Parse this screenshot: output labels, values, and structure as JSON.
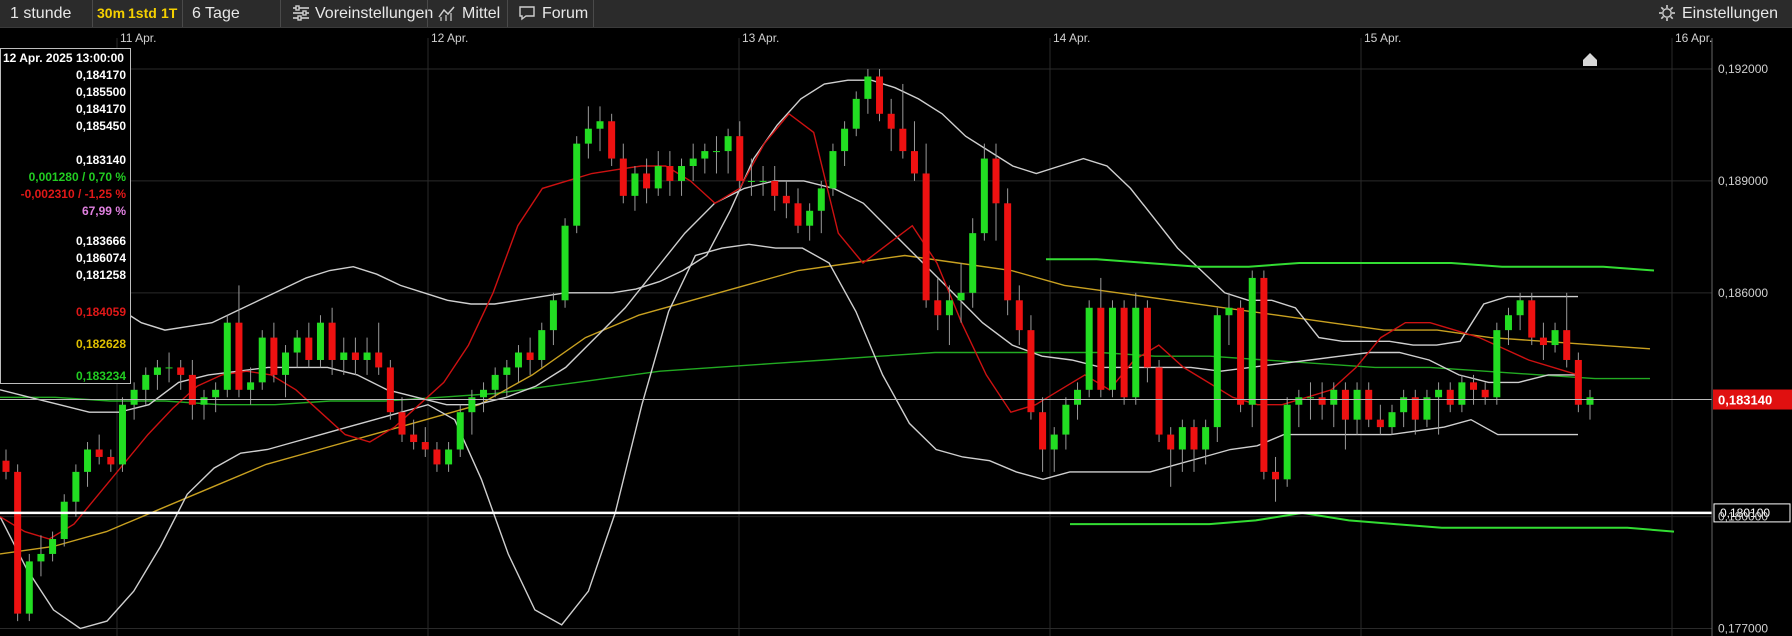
{
  "toolbar": {
    "interval_label": "1 stunde",
    "tf_30m": "30m",
    "tf_1std": "1std",
    "tf_1t": "1T",
    "range_label": "6 Tage",
    "presets_label": "Voreinstellungen",
    "indicator_label": "Mittel",
    "forum_label": "Forum",
    "settings_label": "Einstellungen"
  },
  "colors": {
    "up": "#22dd22",
    "down": "#ee1111",
    "bollinger": "#cfcfcf",
    "ma_fast": "#cc1111",
    "ma_mid": "#c8a020",
    "ma_slow": "#22aa22",
    "channel": "#33dd33"
  },
  "infobox": {
    "date": "12 Apr. 2025 13:00:00",
    "open": "0,184170",
    "high": "0,185500",
    "low": "0,184170",
    "close": "0,185450",
    "last": "0,183140",
    "change_pos": "0,001280 / 0,70 %",
    "change_neg": "-0,002310 / -1,25 %",
    "pct": "67,99 %",
    "v1": "0,183666",
    "v2": "0,186074",
    "v3": "0,181258",
    "ma_red": "0,184059",
    "ma_yellow": "0,182628",
    "ma_green": "0,183234"
  },
  "chart_data": {
    "type": "candlestick",
    "x_labels": [
      "11 Apr.",
      "12 Apr.",
      "13 Apr.",
      "14 Apr.",
      "15 Apr.",
      "16 Apr."
    ],
    "y_ticks": [
      "0,192000",
      "0,189000",
      "0,186000",
      "0,180000",
      "0,177000"
    ],
    "ylim": [
      0.1768,
      0.1931
    ],
    "last_price": 0.18314,
    "last_price_label": "0,183140",
    "support_level": 0.1801,
    "support_label": "0,180100",
    "grid": true,
    "candles": [
      [
        0.1815,
        0.1818,
        0.181,
        0.1812
      ],
      [
        0.1812,
        0.1814,
        0.1772,
        0.1774
      ],
      [
        0.1774,
        0.179,
        0.1772,
        0.1788
      ],
      [
        0.1788,
        0.1795,
        0.1784,
        0.179
      ],
      [
        0.179,
        0.1796,
        0.1788,
        0.1794
      ],
      [
        0.1794,
        0.1806,
        0.1792,
        0.1804
      ],
      [
        0.1804,
        0.1814,
        0.18,
        0.1812
      ],
      [
        0.1812,
        0.182,
        0.1808,
        0.1818
      ],
      [
        0.1818,
        0.1822,
        0.1814,
        0.1816
      ],
      [
        0.1816,
        0.1818,
        0.1812,
        0.1814
      ],
      [
        0.1814,
        0.1832,
        0.1812,
        0.183
      ],
      [
        0.183,
        0.1836,
        0.1826,
        0.1834
      ],
      [
        0.1834,
        0.184,
        0.183,
        0.1838
      ],
      [
        0.1838,
        0.1842,
        0.1834,
        0.184
      ],
      [
        0.184,
        0.1844,
        0.1836,
        0.184
      ],
      [
        0.184,
        0.1842,
        0.1834,
        0.1838
      ],
      [
        0.1838,
        0.1842,
        0.1826,
        0.183
      ],
      [
        0.183,
        0.1834,
        0.1826,
        0.1832
      ],
      [
        0.1832,
        0.1836,
        0.1828,
        0.1834
      ],
      [
        0.1834,
        0.1854,
        0.1832,
        0.1852
      ],
      [
        0.1852,
        0.1862,
        0.1832,
        0.1834
      ],
      [
        0.1834,
        0.184,
        0.183,
        0.1836
      ],
      [
        0.1836,
        0.185,
        0.1834,
        0.1848
      ],
      [
        0.1848,
        0.1852,
        0.1836,
        0.1838
      ],
      [
        0.1838,
        0.1846,
        0.1832,
        0.1844
      ],
      [
        0.1844,
        0.185,
        0.184,
        0.1848
      ],
      [
        0.1848,
        0.1852,
        0.184,
        0.1842
      ],
      [
        0.1842,
        0.1854,
        0.184,
        0.1852
      ],
      [
        0.1852,
        0.1856,
        0.1838,
        0.1842
      ],
      [
        0.1842,
        0.1848,
        0.1838,
        0.1844
      ],
      [
        0.1844,
        0.1848,
        0.1838,
        0.1842
      ],
      [
        0.1842,
        0.1848,
        0.1838,
        0.1844
      ],
      [
        0.1844,
        0.1852,
        0.1838,
        0.184
      ],
      [
        0.184,
        0.1842,
        0.1826,
        0.1828
      ],
      [
        0.1828,
        0.1832,
        0.182,
        0.1822
      ],
      [
        0.1822,
        0.1826,
        0.1818,
        0.182
      ],
      [
        0.182,
        0.1824,
        0.1816,
        0.1818
      ],
      [
        0.1818,
        0.182,
        0.1812,
        0.1814
      ],
      [
        0.1814,
        0.182,
        0.1812,
        0.1818
      ],
      [
        0.1818,
        0.183,
        0.1816,
        0.1828
      ],
      [
        0.1828,
        0.1834,
        0.1822,
        0.1832
      ],
      [
        0.1832,
        0.1836,
        0.1828,
        0.1834
      ],
      [
        0.1834,
        0.184,
        0.1832,
        0.1838
      ],
      [
        0.1838,
        0.1842,
        0.1832,
        0.184
      ],
      [
        0.184,
        0.1846,
        0.1836,
        0.1844
      ],
      [
        0.1844,
        0.1848,
        0.1838,
        0.1842
      ],
      [
        0.1842,
        0.1852,
        0.184,
        0.185
      ],
      [
        0.185,
        0.186,
        0.1846,
        0.1858
      ],
      [
        0.1858,
        0.188,
        0.1856,
        0.1878
      ],
      [
        0.1878,
        0.1902,
        0.1876,
        0.19
      ],
      [
        0.19,
        0.191,
        0.1896,
        0.1904
      ],
      [
        0.1904,
        0.191,
        0.1898,
        0.1906
      ],
      [
        0.1906,
        0.1908,
        0.1894,
        0.1896
      ],
      [
        0.1896,
        0.19,
        0.1884,
        0.1886
      ],
      [
        0.1886,
        0.1894,
        0.1882,
        0.1892
      ],
      [
        0.1892,
        0.1896,
        0.1884,
        0.1888
      ],
      [
        0.1888,
        0.1898,
        0.1886,
        0.1894
      ],
      [
        0.1894,
        0.1898,
        0.1886,
        0.189
      ],
      [
        0.189,
        0.1896,
        0.1886,
        0.1894
      ],
      [
        0.1894,
        0.19,
        0.189,
        0.1896
      ],
      [
        0.1896,
        0.19,
        0.1892,
        0.1898
      ],
      [
        0.1898,
        0.1902,
        0.1892,
        0.1898
      ],
      [
        0.1898,
        0.1904,
        0.1892,
        0.1902
      ],
      [
        0.1902,
        0.1906,
        0.1888,
        0.189
      ],
      [
        0.189,
        0.1896,
        0.1886,
        0.189
      ],
      [
        0.189,
        0.1894,
        0.1886,
        0.189
      ],
      [
        0.189,
        0.1894,
        0.1882,
        0.1886
      ],
      [
        0.1886,
        0.189,
        0.188,
        0.1884
      ],
      [
        0.1884,
        0.1888,
        0.1876,
        0.1878
      ],
      [
        0.1878,
        0.1884,
        0.1874,
        0.1882
      ],
      [
        0.1882,
        0.189,
        0.1876,
        0.1888
      ],
      [
        0.1888,
        0.19,
        0.1886,
        0.1898
      ],
      [
        0.1898,
        0.1906,
        0.1894,
        0.1904
      ],
      [
        0.1904,
        0.1914,
        0.1902,
        0.1912
      ],
      [
        0.1912,
        0.192,
        0.1908,
        0.1918
      ],
      [
        0.1918,
        0.192,
        0.1906,
        0.1908
      ],
      [
        0.1908,
        0.1912,
        0.1898,
        0.1904
      ],
      [
        0.1904,
        0.1916,
        0.1896,
        0.1898
      ],
      [
        0.1898,
        0.1906,
        0.189,
        0.1892
      ],
      [
        0.1892,
        0.19,
        0.1856,
        0.1858
      ],
      [
        0.1858,
        0.1864,
        0.185,
        0.1854
      ],
      [
        0.1854,
        0.1862,
        0.1846,
        0.1858
      ],
      [
        0.1858,
        0.1868,
        0.1852,
        0.186
      ],
      [
        0.186,
        0.188,
        0.1856,
        0.1876
      ],
      [
        0.1876,
        0.19,
        0.1874,
        0.1896
      ],
      [
        0.1896,
        0.19,
        0.1874,
        0.1884
      ],
      [
        0.1884,
        0.1888,
        0.1854,
        0.1858
      ],
      [
        0.1858,
        0.1862,
        0.1846,
        0.185
      ],
      [
        0.185,
        0.1854,
        0.1826,
        0.1828
      ],
      [
        0.1828,
        0.1832,
        0.1812,
        0.1818
      ],
      [
        0.1818,
        0.1824,
        0.1812,
        0.1822
      ],
      [
        0.1822,
        0.1832,
        0.1818,
        0.183
      ],
      [
        0.183,
        0.1836,
        0.1826,
        0.1834
      ],
      [
        0.1834,
        0.1858,
        0.1832,
        0.1856
      ],
      [
        0.1856,
        0.1864,
        0.1832,
        0.1834
      ],
      [
        0.1834,
        0.1858,
        0.1832,
        0.1856
      ],
      [
        0.1856,
        0.1858,
        0.183,
        0.1832
      ],
      [
        0.1832,
        0.186,
        0.183,
        0.1856
      ],
      [
        0.1856,
        0.1858,
        0.1836,
        0.184
      ],
      [
        0.184,
        0.1842,
        0.182,
        0.1822
      ],
      [
        0.1822,
        0.1824,
        0.1808,
        0.1818
      ],
      [
        0.1818,
        0.1826,
        0.1812,
        0.1824
      ],
      [
        0.1824,
        0.1826,
        0.1812,
        0.1818
      ],
      [
        0.1818,
        0.1826,
        0.1814,
        0.1824
      ],
      [
        0.1824,
        0.1856,
        0.182,
        0.1854
      ],
      [
        0.1854,
        0.186,
        0.1846,
        0.1856
      ],
      [
        0.1856,
        0.1858,
        0.1828,
        0.183
      ],
      [
        0.183,
        0.1866,
        0.1824,
        0.1864
      ],
      [
        0.1864,
        0.1866,
        0.181,
        0.1812
      ],
      [
        0.1812,
        0.1816,
        0.1804,
        0.181
      ],
      [
        0.181,
        0.1832,
        0.1808,
        0.183
      ],
      [
        0.183,
        0.1834,
        0.1824,
        0.1832
      ],
      [
        0.1832,
        0.1836,
        0.1826,
        0.1832
      ],
      [
        0.1832,
        0.1836,
        0.1826,
        0.183
      ],
      [
        0.183,
        0.1836,
        0.1824,
        0.1834
      ],
      [
        0.1834,
        0.1836,
        0.1818,
        0.1826
      ],
      [
        0.1826,
        0.1836,
        0.1822,
        0.1834
      ],
      [
        0.1834,
        0.1836,
        0.1824,
        0.1826
      ],
      [
        0.1826,
        0.183,
        0.1822,
        0.1824
      ],
      [
        0.1824,
        0.183,
        0.1822,
        0.1828
      ],
      [
        0.1828,
        0.1834,
        0.1824,
        0.1832
      ],
      [
        0.1832,
        0.1834,
        0.1822,
        0.1826
      ],
      [
        0.1826,
        0.1834,
        0.1824,
        0.1832
      ],
      [
        0.1832,
        0.1836,
        0.1822,
        0.1834
      ],
      [
        0.1834,
        0.1836,
        0.1828,
        0.183
      ],
      [
        0.183,
        0.1838,
        0.1828,
        0.1836
      ],
      [
        0.1836,
        0.1838,
        0.183,
        0.1834
      ],
      [
        0.1834,
        0.1836,
        0.183,
        0.1832
      ],
      [
        0.1832,
        0.1852,
        0.183,
        0.185
      ],
      [
        0.185,
        0.1856,
        0.1846,
        0.1854
      ],
      [
        0.1854,
        0.186,
        0.185,
        0.1858
      ],
      [
        0.1858,
        0.186,
        0.1846,
        0.1848
      ],
      [
        0.1848,
        0.1852,
        0.1842,
        0.1846
      ],
      [
        0.1846,
        0.1852,
        0.1844,
        0.185
      ],
      [
        0.185,
        0.186,
        0.184,
        0.1842
      ],
      [
        0.1842,
        0.1844,
        0.1828,
        0.183
      ],
      [
        0.183,
        0.1834,
        0.1826,
        0.1832
      ]
    ],
    "bollinger_upper": [
      0.188,
      0.188,
      0.1876,
      0.187,
      0.1864,
      0.1856,
      0.1852,
      0.185,
      0.1851,
      0.1852,
      0.1855,
      0.1858,
      0.1861,
      0.1864,
      0.1866,
      0.1867,
      0.1865,
      0.1862,
      0.186,
      0.1858,
      0.1857,
      0.1857,
      0.1858,
      0.1859,
      0.186,
      0.186,
      0.186,
      0.1861,
      0.1863,
      0.1866,
      0.187,
      0.1882,
      0.1896,
      0.1905,
      0.1912,
      0.1916,
      0.1917,
      0.1917,
      0.1915,
      0.1912,
      0.1908,
      0.1902,
      0.1898,
      0.1894,
      0.1892,
      0.1894,
      0.1896,
      0.1894,
      0.1888,
      0.188,
      0.1872,
      0.1866,
      0.186,
      0.1858,
      0.1858,
      0.1856,
      0.1848,
      0.1847,
      0.1847,
      0.1847,
      0.1846,
      0.1846,
      0.1847,
      0.1857,
      0.1859,
      0.1859,
      0.1859,
      0.1859
    ],
    "bollinger_lower": [
      0.18,
      0.1786,
      0.1775,
      0.177,
      0.1772,
      0.178,
      0.1792,
      0.1806,
      0.1813,
      0.1817,
      0.1818,
      0.182,
      0.1822,
      0.1824,
      0.1826,
      0.1828,
      0.183,
      0.1826,
      0.181,
      0.179,
      0.1775,
      0.1771,
      0.178,
      0.1801,
      0.183,
      0.1855,
      0.187,
      0.1872,
      0.1873,
      0.1872,
      0.1872,
      0.1868,
      0.1855,
      0.1838,
      0.1825,
      0.1818,
      0.1816,
      0.1815,
      0.1812,
      0.181,
      0.1812,
      0.1812,
      0.1812,
      0.1812,
      0.1814,
      0.1816,
      0.1818,
      0.1819,
      0.1822,
      0.1822,
      0.1822,
      0.1822,
      0.1822,
      0.1823,
      0.1824,
      0.1826,
      0.1822,
      0.1822,
      0.1822,
      0.1822
    ],
    "bollinger_mid": [
      0.1834,
      0.1832,
      0.183,
      0.1828,
      0.1828,
      0.183,
      0.1836,
      0.1838,
      0.1839,
      0.184,
      0.184,
      0.184,
      0.1838,
      0.1834,
      0.1832,
      0.183,
      0.183,
      0.1832,
      0.1835,
      0.184,
      0.1848,
      0.1856,
      0.1866,
      0.1876,
      0.1884,
      0.1888,
      0.189,
      0.189,
      0.1888,
      0.1884,
      0.1876,
      0.1868,
      0.186,
      0.1852,
      0.1846,
      0.1843,
      0.1842,
      0.184,
      0.184,
      0.184,
      0.184,
      0.1839,
      0.184,
      0.1841,
      0.1842,
      0.1843,
      0.1844,
      0.1844,
      0.1842,
      0.1838,
      0.1836,
      0.1836,
      0.1838,
      0.1838
    ],
    "ma_red": [
      0.18,
      0.1796,
      0.1794,
      0.1798,
      0.1806,
      0.1814,
      0.1822,
      0.1829,
      0.1835,
      0.1838,
      0.1839,
      0.1838,
      0.1834,
      0.1828,
      0.1822,
      0.182,
      0.1824,
      0.183,
      0.1836,
      0.1846,
      0.186,
      0.1878,
      0.1888,
      0.189,
      0.1892,
      0.1893,
      0.1894,
      0.1894,
      0.189,
      0.1884,
      0.1888,
      0.19,
      0.1908,
      0.1903,
      0.1876,
      0.1868,
      0.1873,
      0.1878,
      0.1868,
      0.1852,
      0.1838,
      0.1828,
      0.183,
      0.1834,
      0.1838,
      0.1834,
      0.1842,
      0.1846,
      0.184,
      0.1836,
      0.1832,
      0.183,
      0.183,
      0.1832,
      0.1834,
      0.184,
      0.1848,
      0.1852,
      0.1852,
      0.185,
      0.1848,
      0.1845,
      0.1842,
      0.184,
      0.1838
    ],
    "ma_yellow": [
      0.179,
      0.1792,
      0.1796,
      0.1802,
      0.1808,
      0.1814,
      0.1818,
      0.1822,
      0.1826,
      0.183,
      0.1838,
      0.1848,
      0.1854,
      0.1858,
      0.1862,
      0.1866,
      0.1868,
      0.187,
      0.1868,
      0.1866,
      0.1862,
      0.186,
      0.1858,
      0.1856,
      0.1854,
      0.1852,
      0.185,
      0.185,
      0.1848,
      0.1847,
      0.1846,
      0.1845
    ],
    "ma_green": [
      0.1832,
      0.1832,
      0.1831,
      0.1831,
      0.183,
      0.183,
      0.1831,
      0.1831,
      0.1832,
      0.1833,
      0.1835,
      0.1837,
      0.1839,
      0.184,
      0.1841,
      0.1842,
      0.1843,
      0.1844,
      0.1844,
      0.1844,
      0.1844,
      0.1843,
      0.1843,
      0.1842,
      0.1841,
      0.184,
      0.184,
      0.1839,
      0.1838,
      0.1837,
      0.1837
    ],
    "channel_upper": [
      0.1869,
      0.1869,
      0.1868,
      0.1867,
      0.1867,
      0.1868,
      0.1868,
      0.1868,
      0.1868,
      0.1867,
      0.1867,
      0.1867,
      0.1866
    ],
    "channel_lower": [
      0.1798,
      0.1798,
      0.1798,
      0.1798,
      0.1799,
      0.1801,
      0.1799,
      0.1798,
      0.1797,
      0.1797,
      0.1797,
      0.1797,
      0.1797,
      0.1796
    ]
  }
}
